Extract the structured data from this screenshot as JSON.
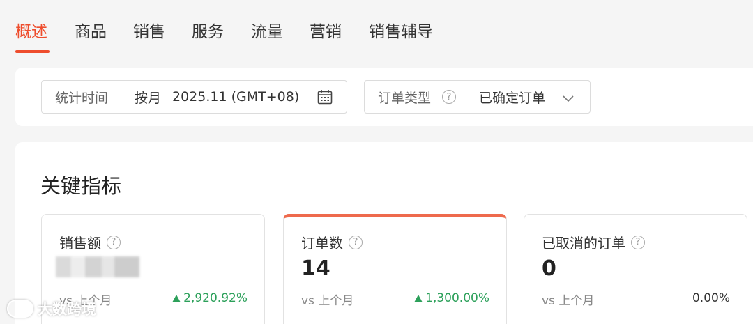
{
  "tabs": [
    {
      "label": "概述",
      "active": true
    },
    {
      "label": "商品",
      "active": false
    },
    {
      "label": "销售",
      "active": false
    },
    {
      "label": "服务",
      "active": false
    },
    {
      "label": "流量",
      "active": false
    },
    {
      "label": "营销",
      "active": false
    },
    {
      "label": "销售辅导",
      "active": false
    }
  ],
  "filters": {
    "stat_time": {
      "label": "统计时间",
      "mode": "按月",
      "value": "2025.11 (GMT+08)",
      "icon": "calendar-icon"
    },
    "order_type": {
      "label": "订单类型",
      "help_icon": "question-icon",
      "value": "已确定订单",
      "icon": "chevron-down-icon"
    }
  },
  "metrics": {
    "title": "关键指标",
    "cards": [
      {
        "label": "销售额",
        "value": "",
        "value_hidden": true,
        "compare_label": "vs 上个月",
        "change": "2,920.92%",
        "trend": "up"
      },
      {
        "label": "订单数",
        "value": "14",
        "compare_label": "vs 上个月",
        "change": "1,300.00%",
        "trend": "up",
        "selected": true
      },
      {
        "label": "已取消的订单",
        "value": "0",
        "compare_label": "vs 上个月",
        "change": "0.00%",
        "trend": "flat"
      }
    ]
  },
  "watermark": {
    "text": "大数跨境"
  },
  "colors": {
    "accent": "#ee4d2d",
    "up": "#2ca05a",
    "background": "#f5f5f5"
  }
}
